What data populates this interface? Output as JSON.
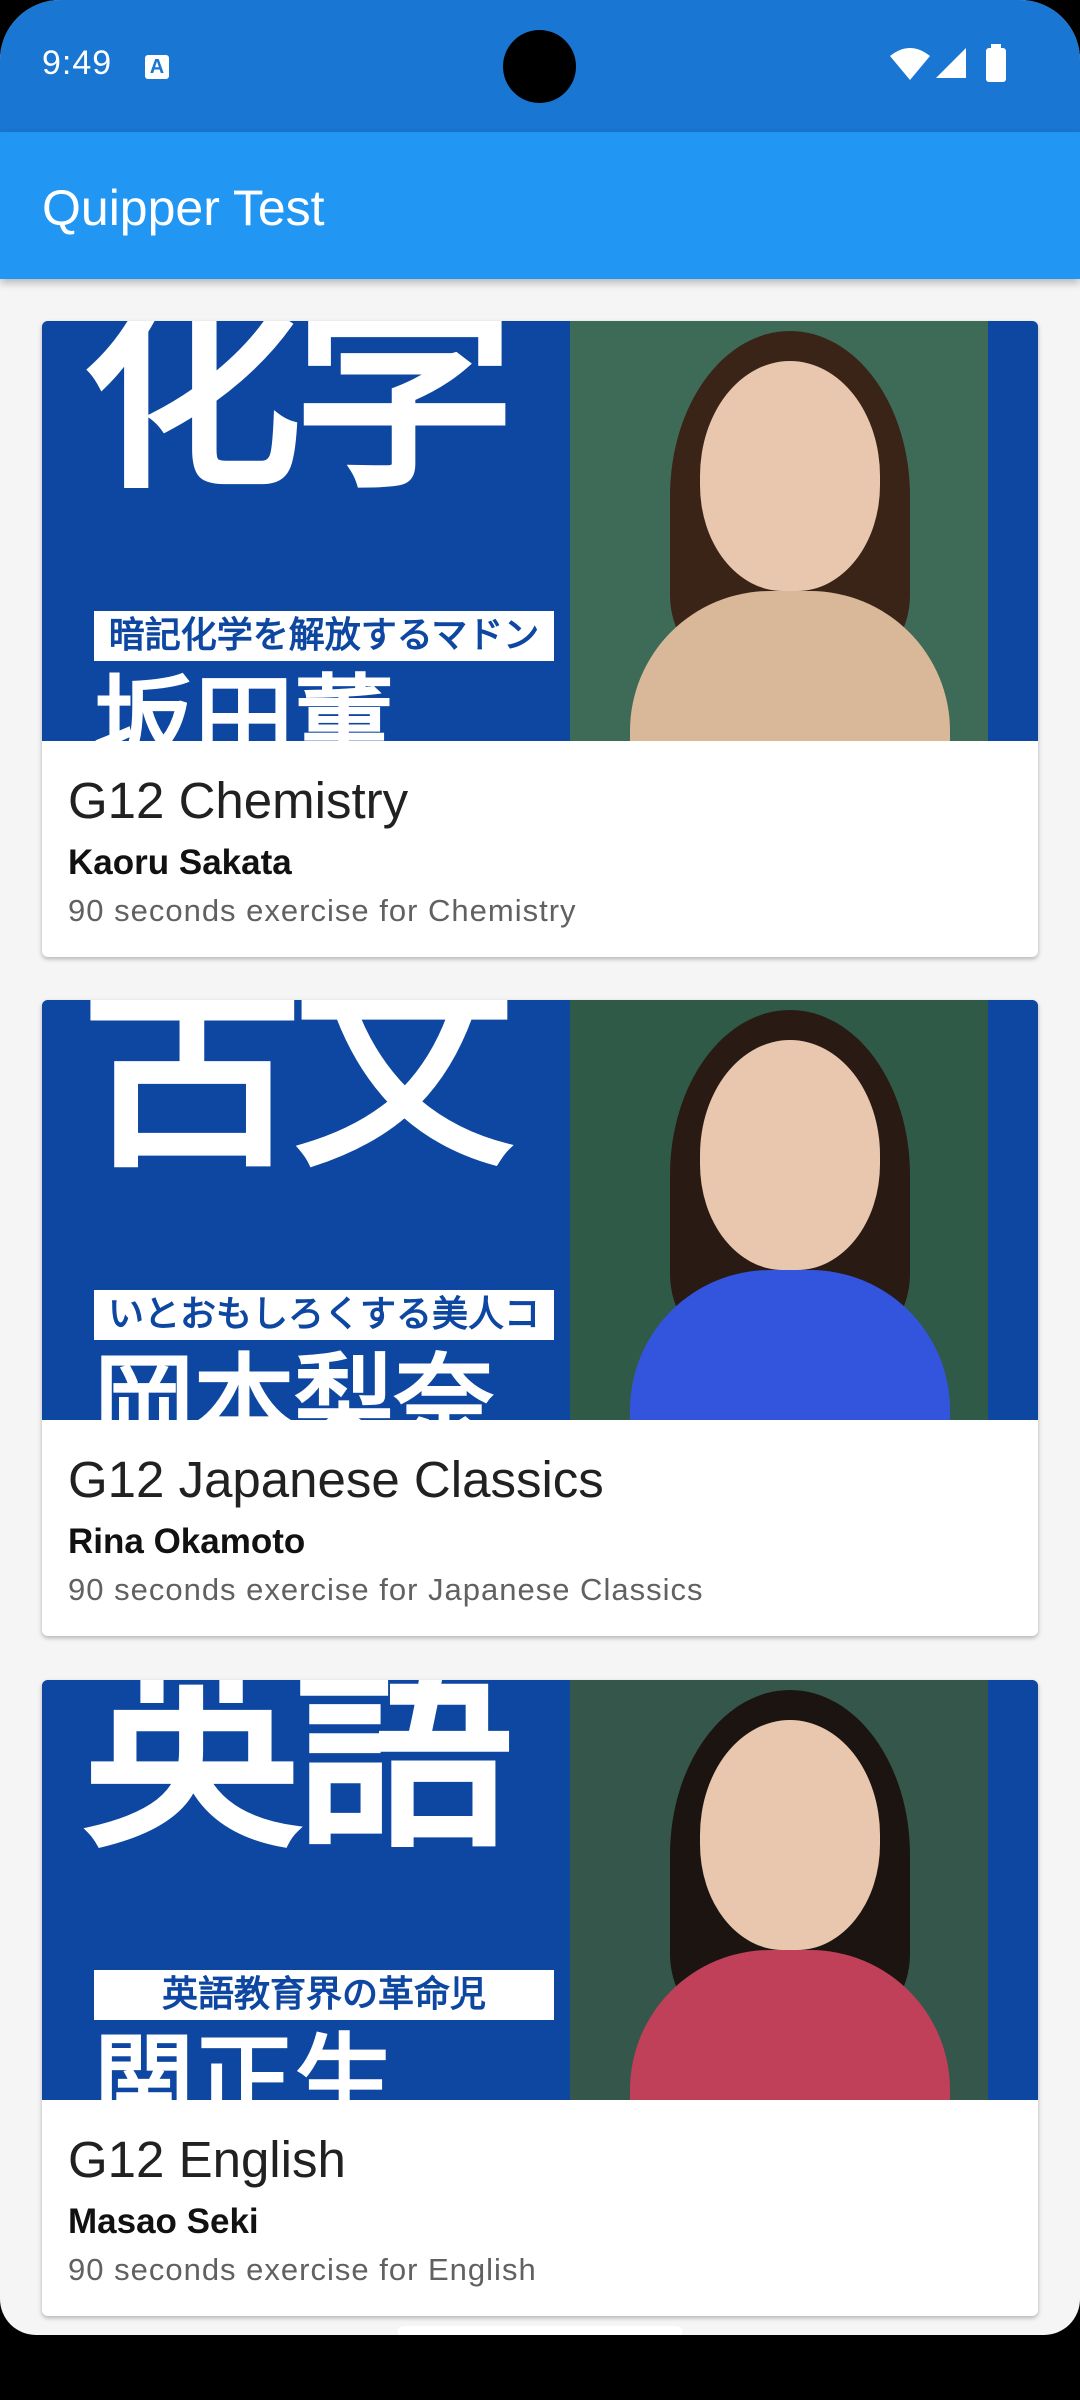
{
  "status_bar": {
    "time": "9:49",
    "notification_icon": "a-icon",
    "icons": [
      "wifi-icon",
      "signal-icon",
      "battery-icon"
    ]
  },
  "app_bar": {
    "title": "Quipper Test"
  },
  "courses": [
    {
      "title": "G12 Chemistry",
      "teacher": "Kaoru Sakata",
      "description": "90 seconds exercise for Chemistry",
      "thumb_big": "化学",
      "thumb_tag": "暗記化学を解放するマドンナ",
      "thumb_name": "坂田薫",
      "photo_bg": "#3e6b57",
      "hair_color": "#3a2418",
      "body_color": "#d9b89a"
    },
    {
      "title": "G12 Japanese Classics",
      "teacher": "Rina Okamoto",
      "description": "90 seconds exercise for Japanese Classics",
      "thumb_big": "古文",
      "thumb_tag": "いとおもしろくする美人コンダクター",
      "thumb_name": "岡本梨奈",
      "photo_bg": "#2f5a48",
      "hair_color": "#2a1a14",
      "body_color": "#3355dd"
    },
    {
      "title": "G12 English",
      "teacher": "Masao Seki",
      "description": "90 seconds exercise for English",
      "thumb_big": "英語",
      "thumb_tag": "英語教育界の革命児",
      "thumb_name": "関正生",
      "photo_bg": "#35564a",
      "hair_color": "#1c1410",
      "body_color": "#c0405a"
    }
  ],
  "colors": {
    "status_bar": "#1976d2",
    "app_bar": "#2196f3",
    "thumb_blue": "#0d47a1"
  }
}
